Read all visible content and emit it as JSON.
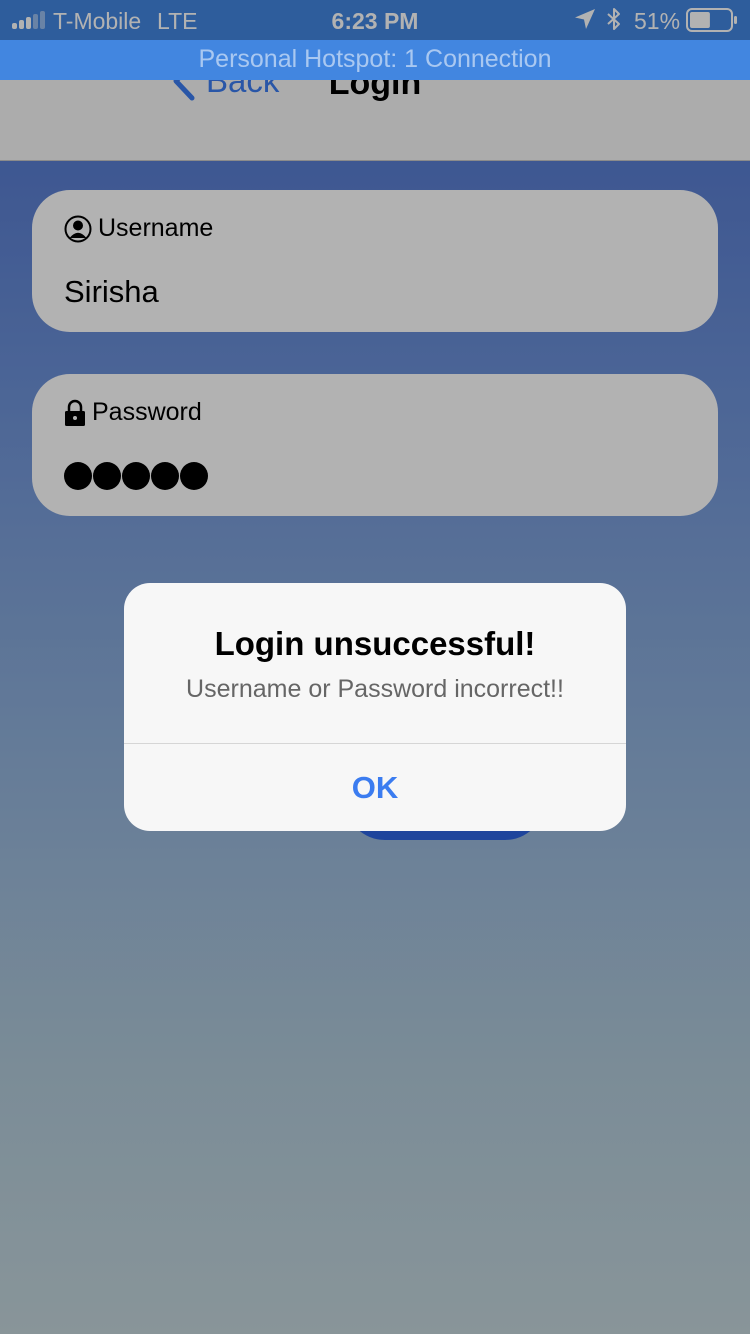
{
  "status_bar": {
    "carrier": "T-Mobile",
    "network": "LTE",
    "time": "6:23 PM",
    "battery": "51%",
    "battery_level": 0.51,
    "hotspot": "Personal Hotspot: 1 Connection",
    "icons": [
      "signal-icon",
      "location-arrow-icon",
      "bluetooth-icon",
      "battery-icon"
    ]
  },
  "nav": {
    "back_label": "Back",
    "title": "Login"
  },
  "form": {
    "username_label": "Username",
    "username_value": "Sirisha",
    "password_label": "Password",
    "password_length": 5
  },
  "alert": {
    "title": "Login unsuccessful!",
    "message": "Username or Password incorrect!!",
    "ok_label": "OK"
  },
  "colors": {
    "accent": "#3b7cf0",
    "status_bar": "#4286e0"
  }
}
